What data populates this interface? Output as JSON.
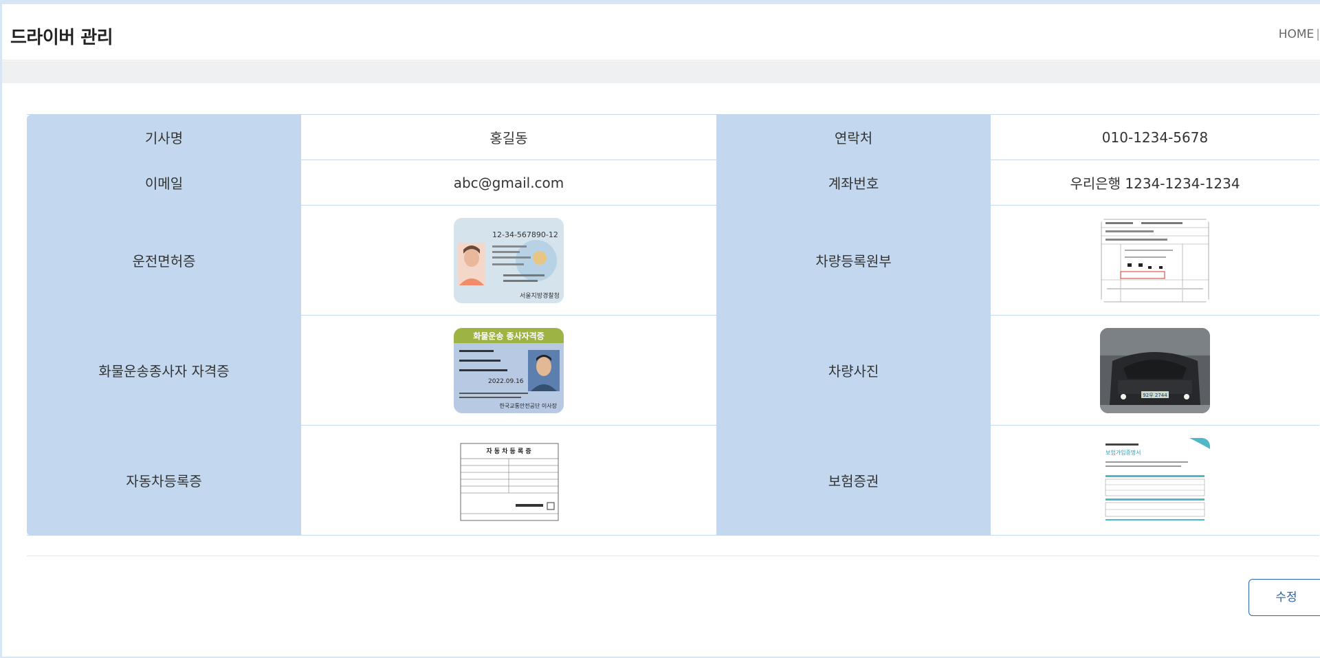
{
  "header": {
    "title": "드라이버 관리",
    "breadcrumb_home": "HOME",
    "breadcrumb_sep": "|"
  },
  "driver": {
    "name_label": "기사명",
    "name_value": "홍길동",
    "phone_label": "연락처",
    "phone_value": "010-1234-5678",
    "email_label": "이메일",
    "email_value": "abc@gmail.com",
    "account_label": "계좌번호",
    "account_value": "우리은행 1234-1234-1234",
    "license_label": "운전면허증",
    "vehicle_reg_doc_label": "차량등록원부",
    "cargo_cert_label": "화물운송종사자 자격증",
    "vehicle_photo_label": "차량사진",
    "car_reg_cert_label": "자동차등록증",
    "insurance_label": "보험증권"
  },
  "thumbnails": {
    "license": {
      "top_text": "12-34-567890-12",
      "bottom_text": "서울지방경찰청"
    },
    "cargo_cert": {
      "title": "화물운송 종사자격증",
      "date": "2022.09.16",
      "footer": "한국교통안전공단 이사장"
    },
    "car_reg_cert": {
      "title": "자 동 차 등 록 증"
    },
    "insurance": {
      "title": "보험가입증명서"
    },
    "vehicle_photo": {
      "plate": "92우 2744"
    }
  },
  "actions": {
    "edit_label": "수정"
  },
  "colors": {
    "label_bg": "#c3d8ef",
    "accent": "#2a63ad"
  }
}
